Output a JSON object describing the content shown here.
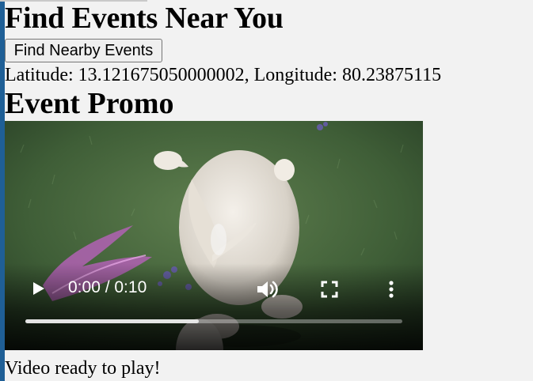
{
  "page": {
    "title": "Find Events Near You",
    "find_button_label": "Find Nearby Events",
    "location_text": "Latitude: 13.121675050000002, Longitude: 80.23875115",
    "promo_heading": "Event Promo",
    "status_text": "Video ready to play!"
  },
  "video": {
    "time_display": "0:00 / 0:10",
    "buffered_fraction": 0.46,
    "icons": {
      "play": "play-icon",
      "volume": "volume-icon",
      "fullscreen": "fullscreen-icon",
      "more": "more-options-icon"
    }
  },
  "colors": {
    "page_background": "#f2f2f2",
    "left_accent_bar": "#1f5f96",
    "video_control_icons": "#ffffff"
  }
}
